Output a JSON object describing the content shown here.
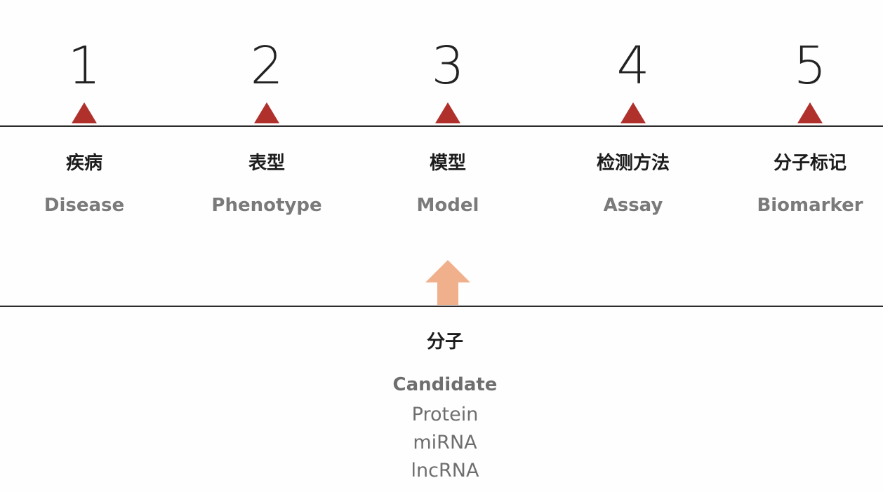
{
  "steps": [
    {
      "number": "1",
      "cn": "疾病",
      "en": "Disease"
    },
    {
      "number": "2",
      "cn": "表型",
      "en": "Phenotype"
    },
    {
      "number": "3",
      "cn": "模型",
      "en": "Model"
    },
    {
      "number": "4",
      "cn": "检测方法",
      "en": "Assay"
    },
    {
      "number": "5",
      "cn": "分子标记",
      "en": "Biomarker"
    }
  ],
  "molecule": {
    "cn": "分子",
    "en": "Candidate",
    "items": [
      "Protein",
      "miRNA",
      "lncRNA"
    ]
  },
  "colors": {
    "marker": "#b0302c",
    "arrow": "#f0b08c",
    "label_gray": "#7a7a7a"
  }
}
